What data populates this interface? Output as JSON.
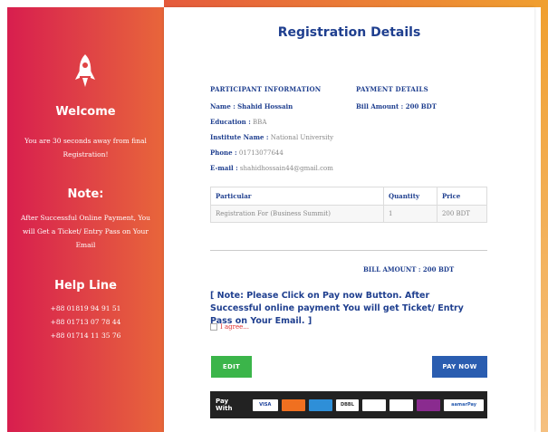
{
  "sidebar": {
    "welcome_title": "Welcome",
    "welcome_text": "You are 30 seconds away from final Registration!",
    "note_title": "Note:",
    "note_text": "After Successful Online Payment, You will Get a Ticket/ Entry Pass on Your Email",
    "helpline_title": "Help Line",
    "phones": [
      "+88 01819 94 91 51",
      "+88 01713 07 78 44",
      "+88 01714 11 35 76"
    ]
  },
  "main": {
    "title": "Registration Details",
    "participant_heading": "PARTICIPANT INFORMATION",
    "payment_heading": "PAYMENT DETAILS",
    "participant": {
      "name_label": "Name :",
      "name_value": "Shahid Hossain",
      "education_label": "Education :",
      "education_value": "BBA",
      "institute_label": "Institute Name :",
      "institute_value": "National University",
      "phone_label": "Phone :",
      "phone_value": "01713077644",
      "email_label": "E-mail :",
      "email_value": "shahidhossain44@gmail.com"
    },
    "payment": {
      "bill_amount": "Bill Amount : 200 BDT"
    },
    "table": {
      "headers": [
        "Particular",
        "Quantity",
        "Price"
      ],
      "rows": [
        [
          "Registration For (Business Summit)",
          "1",
          "200 BDT"
        ]
      ]
    },
    "bill_total": "BILL AMOUNT : 200 BDT",
    "note": "[ Note: Please Click on Pay now Button. After Successful online payment You will get Ticket/ Entry Pass on Your Email. ]",
    "agree_label": "I agree...",
    "edit_button": "EDIT",
    "pay_button": "PAY NOW",
    "pay_with": "Pay With",
    "payment_logos": [
      "VISA",
      "MasterCard",
      "American Express",
      "DBBL",
      "City Bank",
      "bKash",
      "Rocket",
      "aamarPay"
    ]
  },
  "colors": {
    "accent_blue": "#1f3f8f",
    "edit_green": "#3bb54a",
    "pay_blue": "#2a5db0",
    "sidebar_start": "#d81e4e",
    "sidebar_end": "#e8663a"
  }
}
